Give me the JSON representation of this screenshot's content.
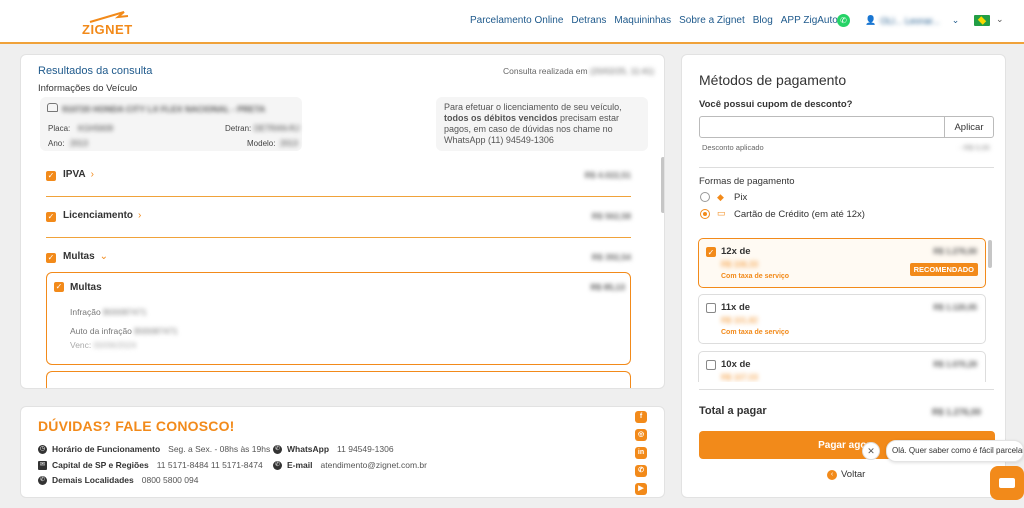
{
  "header": {
    "logo_text": "ZIGNET",
    "nav": [
      "Parcelamento Online",
      "Detrans",
      "Maquininhas",
      "Sobre a Zignet",
      "Blog",
      "APP ZigAuto"
    ],
    "user_name": "OLI... Leonar..."
  },
  "results": {
    "title": "Resultados da consulta",
    "consulta_label": "Consulta realizada em",
    "consulta_date": "(20/02/25, 11:41)",
    "vehicle_info_label": "Informações do Veículo",
    "vehicle": {
      "name": "910720 HONDA CITY LX FLEX NACIONAL - PRETA",
      "placa_label": "Placa:",
      "placa": "KGH5609",
      "detran_label": "Detran:",
      "detran": "DETRAN-RJ",
      "ano_label": "Ano:",
      "ano": "2013",
      "modelo_label": "Modelo:",
      "modelo": "2013"
    },
    "notice": {
      "part1": "Para efetuar o licenciamento de seu veículo,",
      "bold": "todos os débitos vencidos",
      "part2": "precisam estar pagos, em caso de dúvidas nos chame no WhatsApp (11) 94549-1306"
    },
    "sections": [
      {
        "label": "IPVA",
        "chev": "›",
        "amount": "R$ 4.022,51"
      },
      {
        "label": "Licenciamento",
        "chev": "›",
        "amount": "R$ 562,58"
      },
      {
        "label": "Multas",
        "chev": "⌄",
        "amount": "R$ 392,54"
      }
    ],
    "multa": {
      "title": "Multas",
      "amount": "R$ 85,13",
      "infracao_label": "Infração",
      "infracao": "B00087471",
      "auto_label": "Auto da infração",
      "auto": "B00087471",
      "venc_label": "Venc:",
      "venc": "00/06/2024"
    }
  },
  "contact": {
    "title": "DÚVIDAS? FALE CONOSCO!",
    "horario_label": "Horário de Funcionamento",
    "horario": "Seg. a Sex. - 08hs às 19hs",
    "capital_label": "Capital de SP e Regiões",
    "capital": "11 5171-8484  11 5171-8474",
    "demais_label": "Demais Localidades",
    "demais": "0800 5800 094",
    "whatsapp_label": "WhatsApp",
    "whatsapp": "11 94549-1306",
    "email_label": "E-mail",
    "email": "atendimento@zignet.com.br"
  },
  "payment": {
    "title": "Métodos de pagamento",
    "coupon_question": "Você possui cupom de desconto?",
    "coupon_placeholder": "",
    "apply_label": "Aplicar",
    "discount_label": "Desconto aplicado",
    "discount_value": "- R$ 0,00",
    "forms_label": "Formas de pagamento",
    "methods": [
      {
        "label": "Pix",
        "selected": false
      },
      {
        "label": "Cartão de Crédito (em até 12x)",
        "selected": true
      }
    ],
    "installments": [
      {
        "label": "12x de",
        "total": "R$ 1.276,00",
        "value": "R$ 106,33",
        "tax": "Com taxa de serviço",
        "badge": "RECOMENDADO",
        "selected": true
      },
      {
        "label": "11x de",
        "total": "R$ 1.120,05",
        "value": "R$ 101,82",
        "tax": "Com taxa de serviço",
        "badge": "",
        "selected": false
      },
      {
        "label": "10x de",
        "total": "R$ 1.070,29",
        "value": "R$ 107,03",
        "tax": "",
        "badge": "",
        "selected": false
      }
    ],
    "total_label": "Total a pagar",
    "total_value": "R$ 1.276,00",
    "pay_label": "Pagar agora",
    "back_label": "Voltar"
  },
  "chat": {
    "bubble": "Olá. Quer saber como é fácil parcelar?"
  }
}
